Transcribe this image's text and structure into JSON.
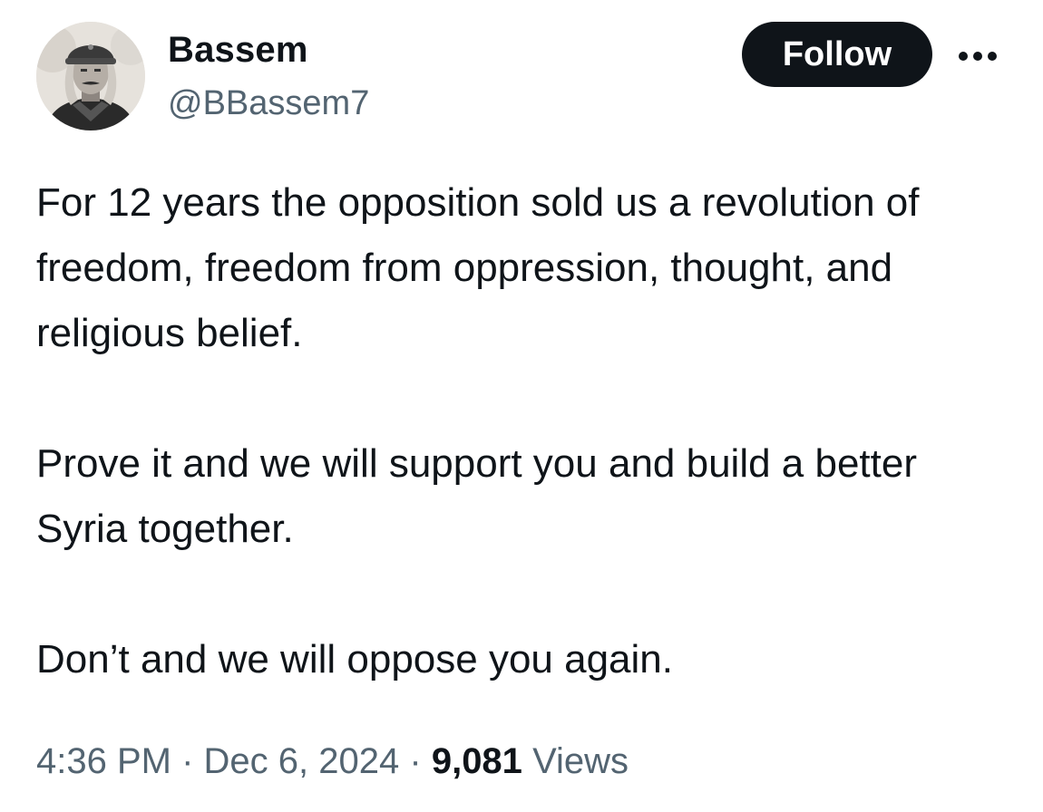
{
  "user": {
    "display_name": "Bassem",
    "handle": "@BBassem7"
  },
  "actions": {
    "follow_label": "Follow",
    "more_icon": "more-horizontal-icon"
  },
  "tweet": {
    "paragraphs": [
      "For 12 years the opposition sold us a revolution of freedom, freedom from oppression, thought, and religious belief.",
      "Prove it and we will support you and build a better Syria together.",
      "Don’t and we will oppose you again."
    ],
    "time": "4:36 PM",
    "separator": "·",
    "date": "Dec 6, 2024",
    "views_count": "9,081",
    "views_label": "Views"
  },
  "colors": {
    "text": "#0f1419",
    "secondary": "#536471",
    "button_bg": "#0f1419",
    "button_text": "#ffffff"
  }
}
